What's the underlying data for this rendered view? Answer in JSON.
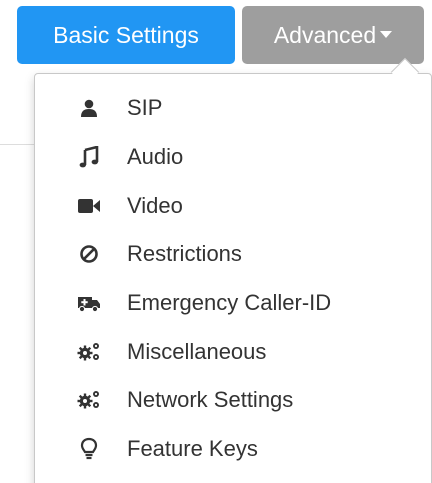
{
  "buttons": {
    "basic_label": "Basic Settings",
    "advanced_label": "Advanced"
  },
  "menu": {
    "items": [
      {
        "label": "SIP",
        "icon": "user-icon"
      },
      {
        "label": "Audio",
        "icon": "music-icon"
      },
      {
        "label": "Video",
        "icon": "video-camera-icon"
      },
      {
        "label": "Restrictions",
        "icon": "ban-icon"
      },
      {
        "label": "Emergency Caller-ID",
        "icon": "ambulance-icon"
      },
      {
        "label": "Miscellaneous",
        "icon": "gears-icon"
      },
      {
        "label": "Network Settings",
        "icon": "gears-icon"
      },
      {
        "label": "Feature Keys",
        "icon": "lightbulb-icon"
      }
    ]
  },
  "colors": {
    "primary": "#2196f3",
    "secondary": "#9e9e9e",
    "menu_text": "#333333",
    "icon": "#333333"
  }
}
